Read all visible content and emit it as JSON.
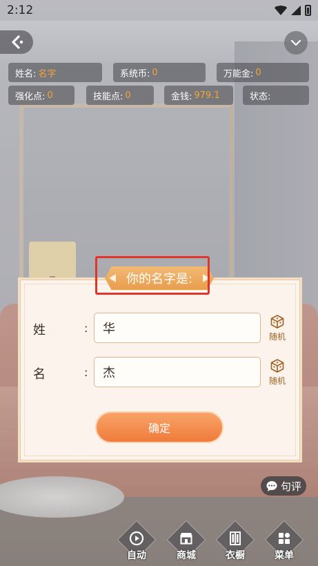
{
  "status_bar": {
    "time": "2:12"
  },
  "stats": {
    "name": {
      "label": "姓名:",
      "value": "名字"
    },
    "system_coins": {
      "label": "系统币:",
      "value": "0"
    },
    "universal_gold": {
      "label": "万能金:",
      "value": "0"
    },
    "enhance_points": {
      "label": "强化点:",
      "value": "0"
    },
    "skill_points": {
      "label": "技能点:",
      "value": "0"
    },
    "money": {
      "label": "金钱:",
      "value": "979.1"
    },
    "state": {
      "label": "状态:",
      "value": ""
    }
  },
  "dialog": {
    "title": "你的名字是:",
    "surname": {
      "label": "姓",
      "colon": ":",
      "value": "华",
      "random_label": "随机"
    },
    "given_name": {
      "label": "名",
      "colon": ":",
      "value": "杰",
      "random_label": "随机"
    },
    "confirm_label": "确定"
  },
  "comment": {
    "label": "句评"
  },
  "nav": [
    {
      "label": "自动",
      "icon": "auto-play-icon"
    },
    {
      "label": "商城",
      "icon": "store-icon"
    },
    {
      "label": "衣橱",
      "icon": "wardrobe-icon"
    },
    {
      "label": "菜单",
      "icon": "menu-grid-icon"
    }
  ],
  "colors": {
    "accent": "#ef7b3a",
    "stat_value": "#f2a636",
    "highlight": "#e0352b"
  }
}
